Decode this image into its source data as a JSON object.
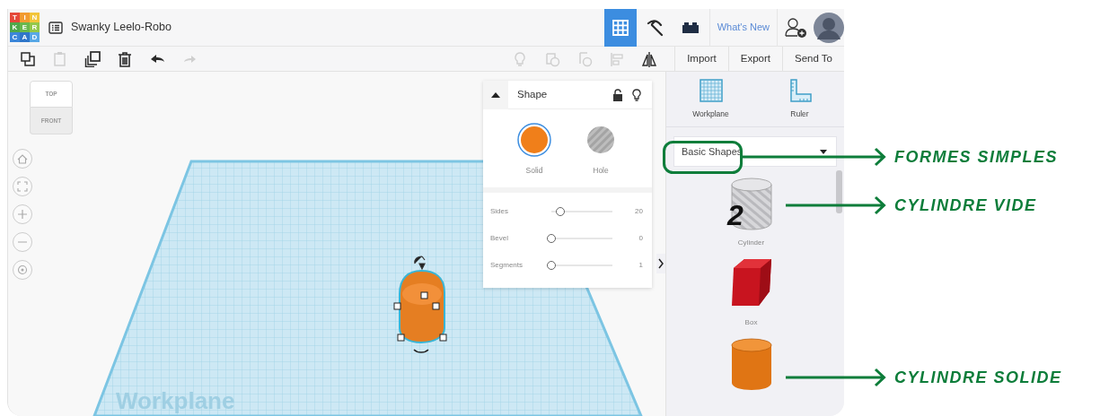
{
  "app": {
    "logo": [
      "T",
      "I",
      "N",
      "K",
      "E",
      "R",
      "C",
      "A",
      "D"
    ],
    "title": "Swanky Leelo-Robo",
    "header_tools": [
      {
        "kind": "grid",
        "selected": true
      },
      {
        "kind": "pickaxe",
        "selected": false
      },
      {
        "kind": "bricks",
        "selected": false
      }
    ],
    "whats_new": "What's New"
  },
  "toolbar": {
    "edit_tools": [
      {
        "kind": "copy",
        "disabled": false
      },
      {
        "kind": "paste",
        "disabled": true
      },
      {
        "kind": "duplicate",
        "disabled": false
      },
      {
        "kind": "delete",
        "disabled": false
      },
      {
        "kind": "undo",
        "disabled": false
      },
      {
        "kind": "redo",
        "disabled": true
      }
    ],
    "shape_tools": [
      {
        "kind": "bulb",
        "disabled": true
      },
      {
        "kind": "group",
        "disabled": true
      },
      {
        "kind": "ungroup",
        "disabled": true
      },
      {
        "kind": "align",
        "disabled": true
      },
      {
        "kind": "mirror",
        "disabled": false
      }
    ],
    "buttons": [
      "Import",
      "Export",
      "Send To"
    ]
  },
  "viewport": {
    "view_cube": {
      "top": "TOP",
      "front": "FRONT"
    },
    "nav_buttons": [
      {
        "kind": "home"
      },
      {
        "kind": "fit"
      },
      {
        "kind": "zoom-in"
      },
      {
        "kind": "zoom-out"
      },
      {
        "kind": "orbit"
      }
    ],
    "workplane_label": "Workplane"
  },
  "inspector": {
    "title": "Shape",
    "modes": [
      {
        "kind": "solid",
        "label": "Solid",
        "selected": true
      },
      {
        "kind": "hole",
        "label": "Hole",
        "selected": false
      }
    ],
    "params": [
      {
        "label": "Sides",
        "level": 0.15,
        "reading": "20"
      },
      {
        "label": "Bevel",
        "level": 0,
        "reading": "0"
      },
      {
        "label": "Segments",
        "level": 0,
        "reading": "1"
      }
    ]
  },
  "library": {
    "tools": [
      {
        "kind": "workplane",
        "label": "Workplane"
      },
      {
        "kind": "ruler",
        "label": "Ruler"
      }
    ],
    "category": "Basic Shapes",
    "shapes": [
      {
        "kind": "cylinder-hole",
        "label": "Cylinder"
      },
      {
        "kind": "box",
        "label": "Box"
      },
      {
        "kind": "cylinder-solid"
      }
    ]
  },
  "annotations": {
    "step_number": "2",
    "callouts": [
      "FORMES SIMPLES",
      "CYLINDRE VIDE",
      "CYLINDRE SOLIDE"
    ]
  }
}
